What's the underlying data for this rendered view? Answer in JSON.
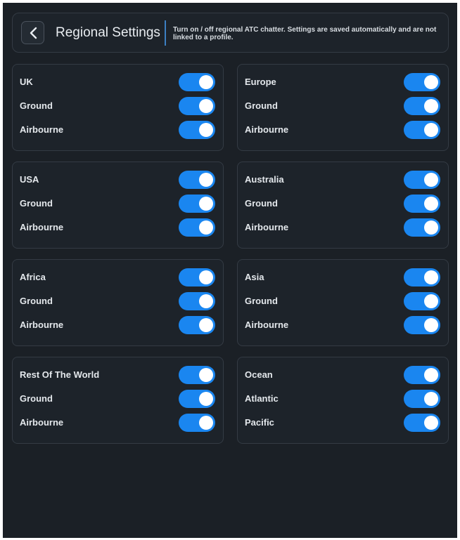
{
  "header": {
    "title": "Regional Settings",
    "description": "Turn on / off regional ATC chatter. Settings are saved automatically and are not linked to a profile."
  },
  "colors": {
    "background": "#1b2026",
    "card": "#1d232a",
    "border": "#343b44",
    "toggle_on": "#1a86f0",
    "divider": "#3c7fc2"
  },
  "icons": {
    "back": "chevron-left-icon"
  },
  "regions": [
    {
      "rows": [
        {
          "label": "UK",
          "on": true
        },
        {
          "label": "Ground",
          "on": true
        },
        {
          "label": "Airbourne",
          "on": true
        }
      ]
    },
    {
      "rows": [
        {
          "label": "Europe",
          "on": true
        },
        {
          "label": "Ground",
          "on": true
        },
        {
          "label": "Airbourne",
          "on": true
        }
      ]
    },
    {
      "rows": [
        {
          "label": "USA",
          "on": true
        },
        {
          "label": "Ground",
          "on": true
        },
        {
          "label": "Airbourne",
          "on": true
        }
      ]
    },
    {
      "rows": [
        {
          "label": "Australia",
          "on": true
        },
        {
          "label": "Ground",
          "on": true
        },
        {
          "label": "Airbourne",
          "on": true
        }
      ]
    },
    {
      "rows": [
        {
          "label": "Africa",
          "on": true
        },
        {
          "label": "Ground",
          "on": true
        },
        {
          "label": "Airbourne",
          "on": true
        }
      ]
    },
    {
      "rows": [
        {
          "label": "Asia",
          "on": true
        },
        {
          "label": "Ground",
          "on": true
        },
        {
          "label": "Airbourne",
          "on": true
        }
      ]
    },
    {
      "rows": [
        {
          "label": "Rest Of The World",
          "on": true
        },
        {
          "label": "Ground",
          "on": true
        },
        {
          "label": "Airbourne",
          "on": true
        }
      ]
    },
    {
      "rows": [
        {
          "label": "Ocean",
          "on": true
        },
        {
          "label": "Atlantic",
          "on": true
        },
        {
          "label": "Pacific",
          "on": true
        }
      ]
    }
  ]
}
